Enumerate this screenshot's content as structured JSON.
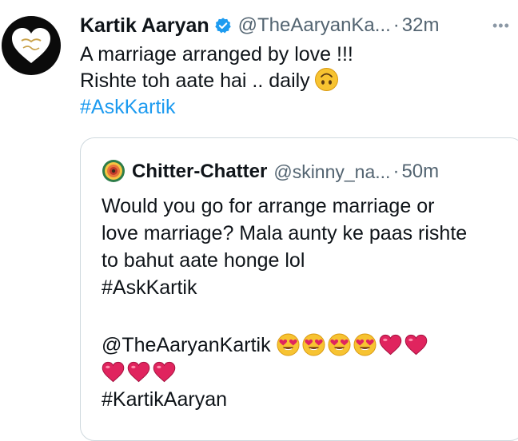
{
  "tweet": {
    "author_name": "Kartik Aaryan",
    "handle": "@TheAaryanKa...",
    "separator": "·",
    "time": "32m",
    "more_icon": "•••",
    "lines": [
      "A marriage arranged by love !!!",
      "Rishte toh aate hai .. daily"
    ],
    "hashtag": "#AskKartik",
    "emoji": "upside-down-face"
  },
  "quote": {
    "author_name": "Chitter-Chatter",
    "handle": "@skinny_na...",
    "separator": "·",
    "time": "50m",
    "lines": [
      "Would you go for arrange marriage or",
      "love marriage? Mala aunty ke paas rishte",
      "to bahut aate honge lol",
      "#AskKartik"
    ],
    "mention": "@TheAaryanKartik",
    "hashtag2": "#KartikAaryan",
    "emojis_row1": [
      "heart-eyes-face",
      "heart-eyes-face",
      "heart-eyes-face",
      "heart-eyes-face",
      "red-heart",
      "red-heart"
    ],
    "emojis_row2": [
      "red-heart",
      "red-heart",
      "red-heart"
    ]
  }
}
